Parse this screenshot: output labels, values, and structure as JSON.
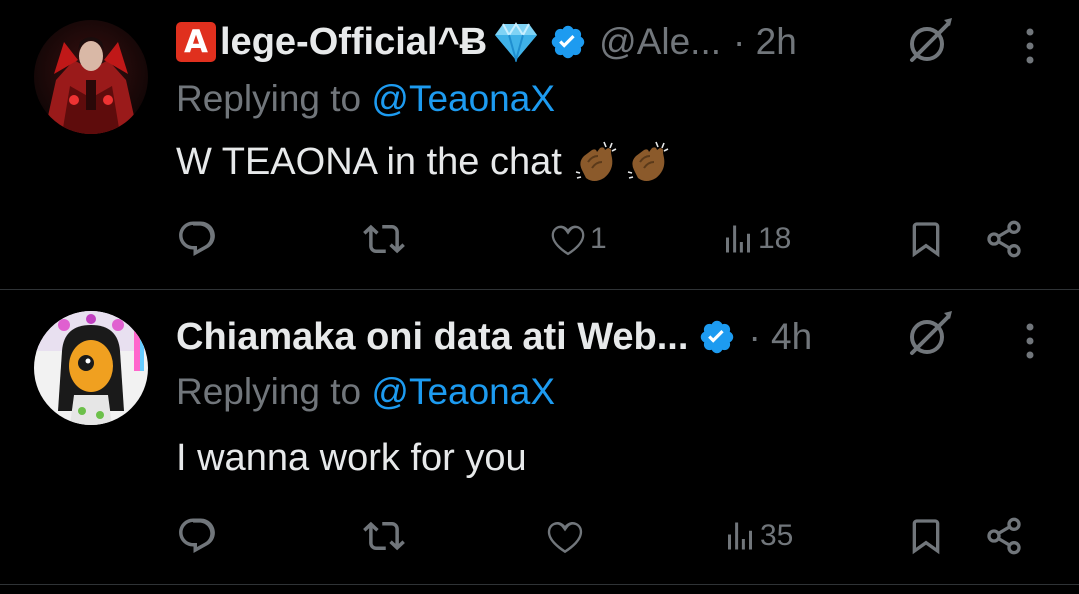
{
  "replies": [
    {
      "display_name": "lege-Official^Ƀ",
      "badge_letter": "A",
      "handle": "@Ale...",
      "time": "· 2h",
      "replying_prefix": "Replying to ",
      "replying_to": "@TeaonaX",
      "text": "W TEAONA in the chat",
      "emoji": [
        "clapping-hands",
        "clapping-hands"
      ],
      "likes": "1",
      "views": "18",
      "verified": true
    },
    {
      "display_name": "Chiamaka oni data ati Web...",
      "time": "· 4h",
      "replying_prefix": "Replying to ",
      "replying_to": "@TeaonaX",
      "text": "I wanna work for you",
      "likes": "",
      "views": "35",
      "verified": true
    }
  ],
  "colors": {
    "background": "#000000",
    "text_primary": "#e7e9ea",
    "text_secondary": "#71767b",
    "accent": "#1d9bf0",
    "divider": "#2f3336"
  },
  "icons": [
    "reply-icon",
    "repost-icon",
    "like-icon",
    "views-icon",
    "bookmark-icon",
    "share-icon",
    "grok-icon",
    "more-icon",
    "verified-icon",
    "diamond-icon"
  ]
}
